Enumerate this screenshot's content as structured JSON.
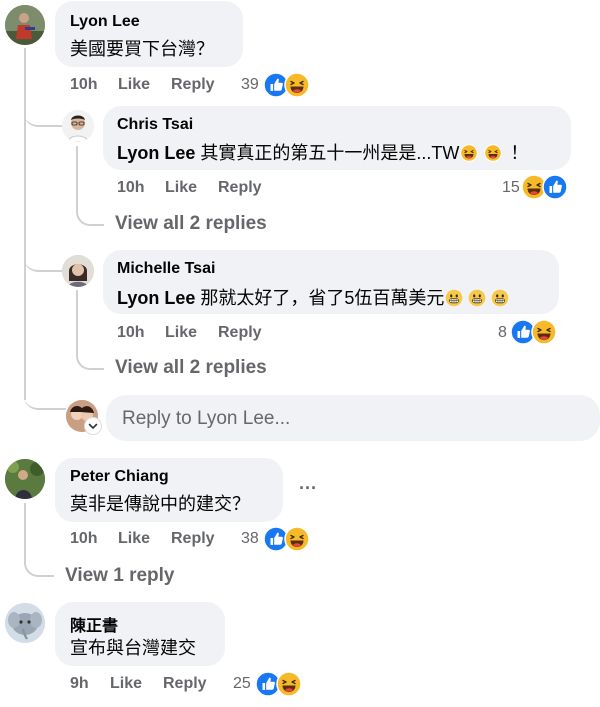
{
  "comments": [
    {
      "name": "Lyon Lee",
      "text": "美國要買下台灣？",
      "time": "10h",
      "like": "Like",
      "reply": "Reply",
      "reaction_count": "39"
    },
    {
      "name": "Chris Tsai",
      "mention": "Lyon Lee",
      "text": " 其實真正的第五十一州是是...TW",
      "text_end": "！",
      "time": "10h",
      "like": "Like",
      "reply": "Reply",
      "reaction_count": "15",
      "view_replies": "View all 2 replies"
    },
    {
      "name": "Michelle Tsai",
      "mention": "Lyon Lee",
      "text": " 那就太好了，省了5伍百萬美元",
      "time": "10h",
      "like": "Like",
      "reply": "Reply",
      "reaction_count": "8",
      "view_replies": "View all 2 replies"
    },
    {
      "name": "Peter Chiang",
      "text": "莫非是傳說中的建交？",
      "time": "10h",
      "like": "Like",
      "reply": "Reply",
      "reaction_count": "38",
      "view_replies": "View 1 reply",
      "more": "···"
    },
    {
      "name": "陳正書",
      "text": "宣布與台灣建交",
      "time": "9h",
      "like": "Like",
      "reply": "Reply",
      "reaction_count": "25"
    }
  ],
  "reply_box": {
    "placeholder": "Reply to Lyon Lee..."
  },
  "colors": {
    "like_blue": "#1877f2",
    "bubble_bg": "#f0f2f5",
    "meta_gray": "#65676b",
    "haha_yellow": "#f7b928"
  }
}
